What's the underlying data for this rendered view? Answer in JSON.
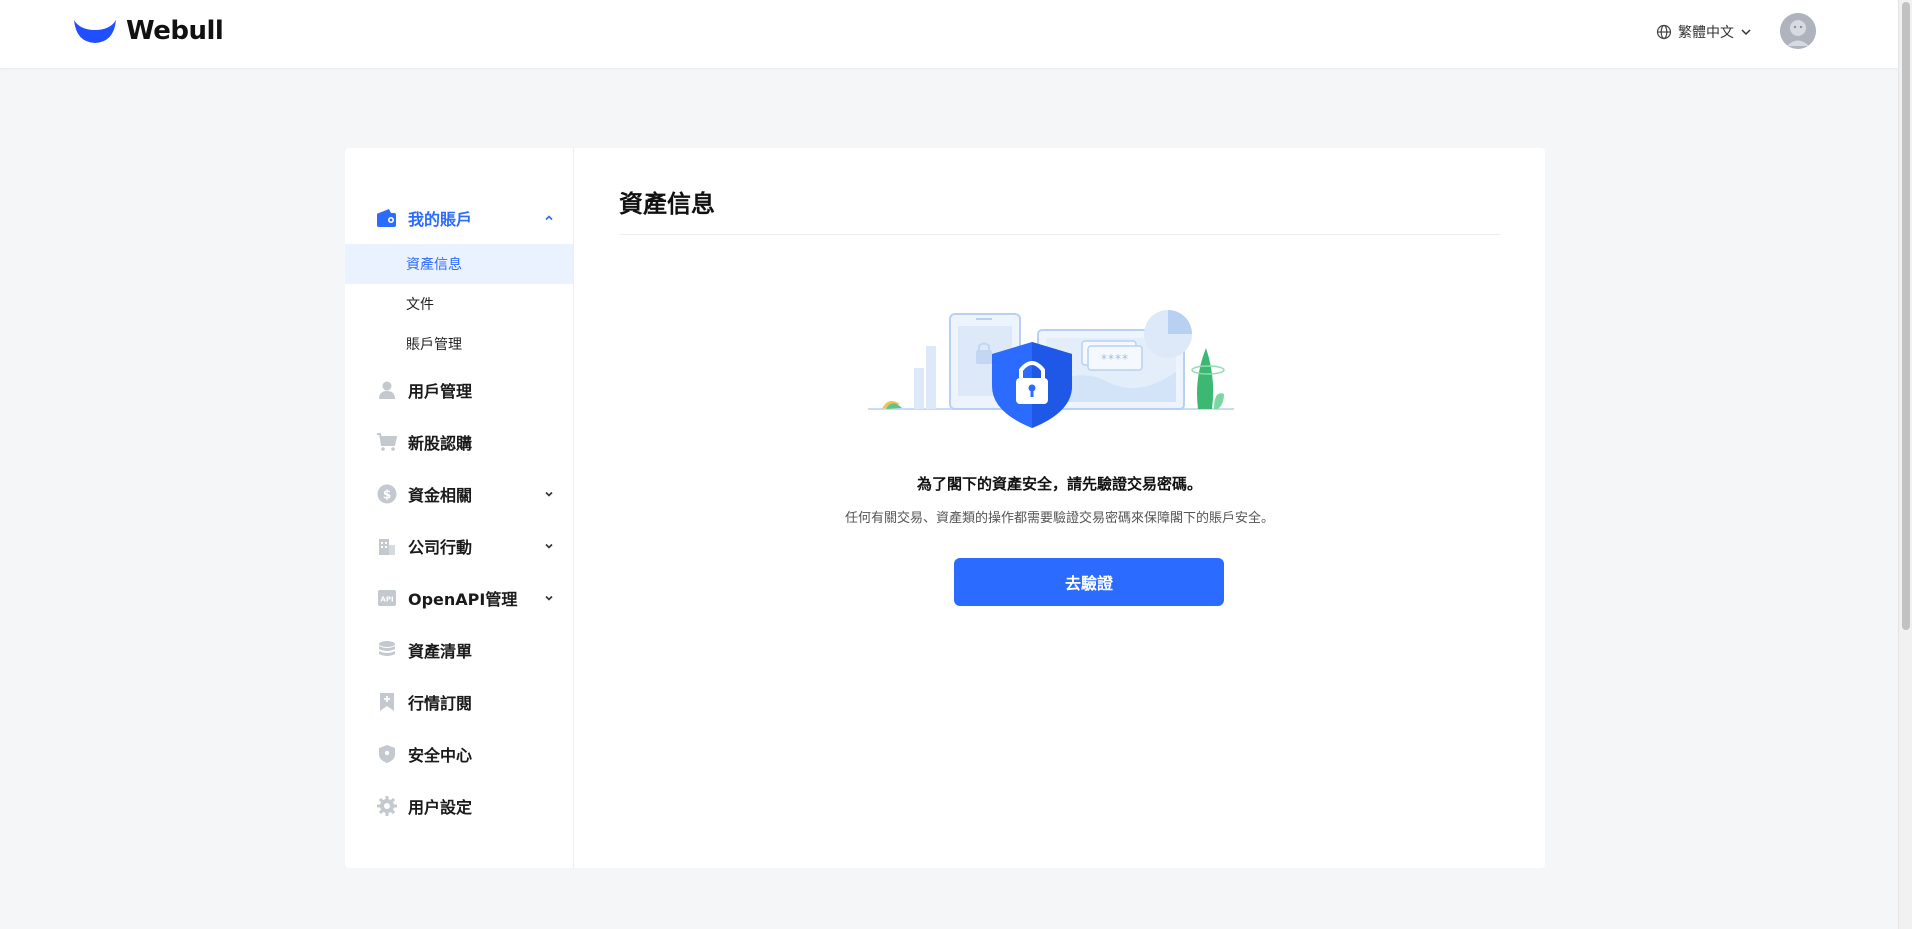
{
  "header": {
    "logo_text": "Webull",
    "language": "繁體中文"
  },
  "sidebar": {
    "my_account": {
      "label": "我的賬戶",
      "sub_items": [
        "資產信息",
        "文件",
        "賬戶管理"
      ]
    },
    "items": [
      {
        "label": "用戶管理",
        "icon": "user-icon",
        "expandable": false
      },
      {
        "label": "新股認購",
        "icon": "cart-icon",
        "expandable": false
      },
      {
        "label": "資金相關",
        "icon": "dollar-icon",
        "expandable": true
      },
      {
        "label": "公司行動",
        "icon": "building-icon",
        "expandable": true
      },
      {
        "label": "OpenAPI管理",
        "icon": "api-icon",
        "expandable": true
      },
      {
        "label": "資產清單",
        "icon": "database-icon",
        "expandable": false
      },
      {
        "label": "行情訂閱",
        "icon": "bookmark-icon",
        "expandable": false
      },
      {
        "label": "安全中心",
        "icon": "shield-icon",
        "expandable": false
      },
      {
        "label": "用户設定",
        "icon": "gear-icon",
        "expandable": false
      }
    ]
  },
  "main": {
    "title": "資產信息",
    "message_title": "為了閣下的資產安全，請先驗證交易密碼。",
    "message_sub": "任何有關交易、資產類的操作都需要驗證交易密碼來保障閣下的賬戶安全。",
    "button_label": "去驗證",
    "password_mask": "****"
  },
  "colors": {
    "accent": "#2b6bff",
    "selected_bg": "#eaf1ff",
    "icon_gray": "#c4c8cf"
  }
}
